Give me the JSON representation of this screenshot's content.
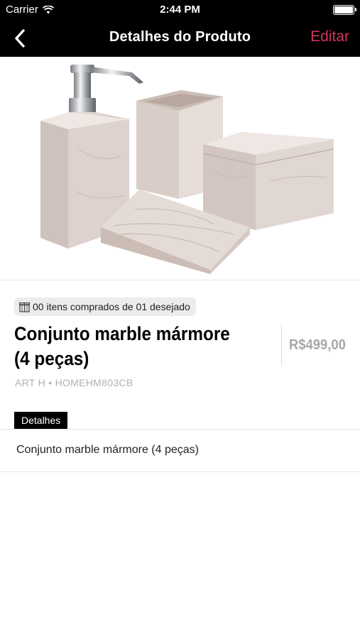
{
  "status_bar": {
    "carrier": "Carrier",
    "time": "2:44 PM",
    "wifi_icon": "wifi-icon",
    "battery_icon": "battery-icon"
  },
  "nav": {
    "back_icon": "chevron-left-icon",
    "title": "Detalhes do Produto",
    "edit_label": "Editar",
    "edit_color": "#d4345c"
  },
  "product": {
    "image_alt": "marble bathroom accessory set",
    "purchase_status": "00 itens comprados de 01 desejado",
    "purchase_icon": "gift-icon",
    "title": "Conjunto marble mármore (4 peças)",
    "price": "R$499,00",
    "sku": "ART H • HOMEHM803CB"
  },
  "details": {
    "tab_label": "Detalhes",
    "description": "Conjunto marble mármore (4 peças)"
  }
}
